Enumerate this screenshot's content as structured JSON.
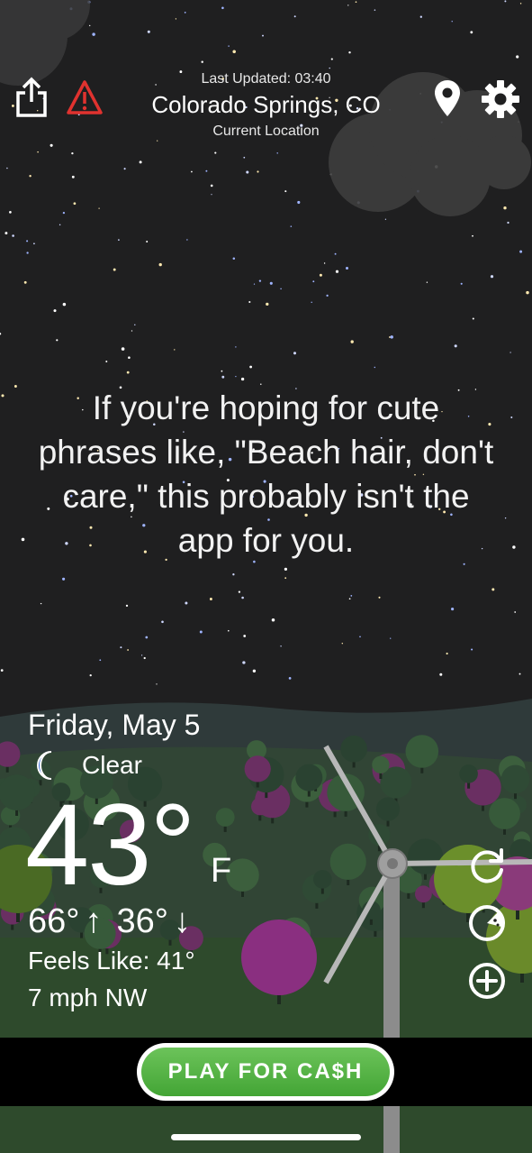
{
  "header": {
    "last_updated": "Last Updated: 03:40",
    "city": "Colorado Springs, CO",
    "location_label": "Current Location"
  },
  "icons": {
    "share": "share-icon",
    "alert": "alert-triangle-icon",
    "location": "location-pin-icon",
    "settings": "gear-icon",
    "condition": "moon-icon",
    "refresh": "refresh-icon",
    "radar": "radar-icon",
    "add": "add-circle-icon"
  },
  "phrase": "If you're hoping for cute phrases like, \"Beach hair, don't care,\" this probably isn't the app for you.",
  "weather": {
    "date": "Friday, May 5",
    "condition": "Clear",
    "temp": "43°",
    "unit": "F",
    "high": "66°",
    "low": "36°",
    "feels_like": "Feels Like: 41°",
    "wind": "7 mph NW"
  },
  "ad": {
    "button_label": "PLAY FOR CA$H"
  },
  "colors": {
    "sky": "#1f1f20",
    "alert_red": "#e0322f",
    "moon_blue": "#3f6fd8",
    "ad_green": "#4caf3e"
  }
}
